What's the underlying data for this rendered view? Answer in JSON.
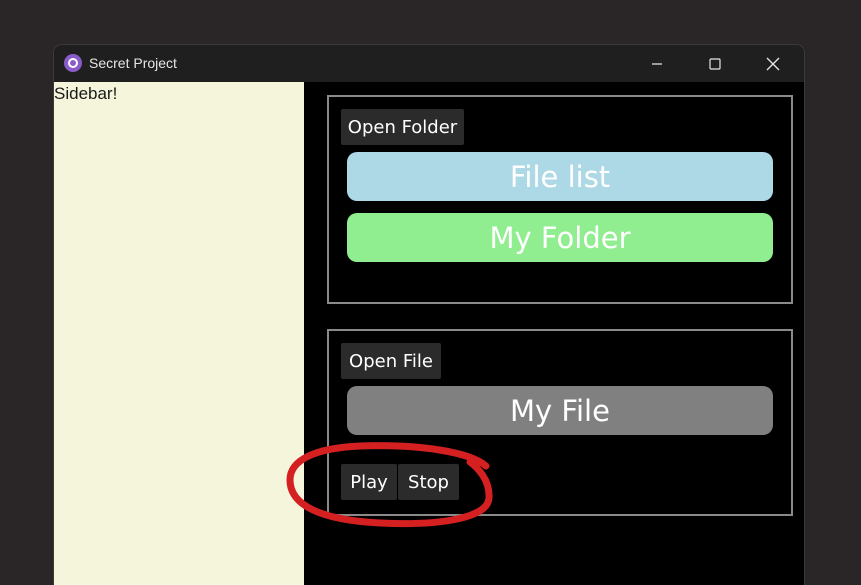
{
  "window": {
    "title": "Secret Project",
    "app_icon": "app-logo-icon",
    "controls": {
      "minimize_icon": "minimize-icon",
      "maximize_icon": "maximize-icon",
      "close_icon": "close-icon"
    }
  },
  "sidebar": {
    "text": "Sidebar!",
    "background": "#f5f5dc"
  },
  "folder_panel": {
    "open_button": "Open Folder",
    "file_list_label": "File list",
    "folder_label": "My Folder",
    "file_list_color": "#add8e6",
    "folder_color": "#90ee90"
  },
  "file_panel": {
    "open_button": "Open File",
    "file_label": "My File",
    "file_color": "#808080",
    "play_button": "Play",
    "stop_button": "Stop"
  },
  "annotation": {
    "color": "#d42020",
    "shape": "hand-drawn-circle"
  }
}
